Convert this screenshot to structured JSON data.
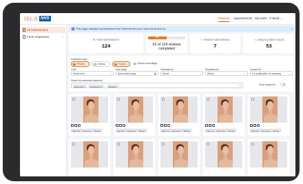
{
  "brand": {
    "logo_text": "ISLA",
    "nhs_badge": "NHS"
  },
  "nav": {
    "patients": "Patients",
    "appointments": "Appointments",
    "my_tasks": "My tasks",
    "user": "Bindi"
  },
  "sidebar": {
    "items": [
      {
        "label": "All submissions"
      },
      {
        "label": "Form responses"
      }
    ]
  },
  "banner": {
    "text": "This page displays submissions from Patients that you have full access to."
  },
  "stats": {
    "total_label": "Total submissions",
    "total_value": "124",
    "progress_badge": "50%",
    "progress_fraction": 0.5,
    "progress_text": "62 of 124 reviews completed",
    "patient_label": "Patient submissions",
    "patient_value": "7",
    "unique_label": "Unique patient count",
    "unique_value": "53"
  },
  "filters": {
    "submission_type_label": "Submission type",
    "chips": [
      {
        "label": "Photos",
        "on": true
      },
      {
        "label": "Videos",
        "on": false
      },
      {
        "label": "Forms",
        "on": true
      },
      {
        "label": "Sound recordings",
        "on": false
      }
    ],
    "form_label": "Form",
    "form_value": "Select form",
    "date_label": "Date range",
    "date_value": "Select date range",
    "submitted_label": "Submitted by",
    "submitted_value": "Select",
    "requested_label": "Requested by",
    "requested_value": "Select",
    "consent_label": "Consent for",
    "consent_value": "For publication, for teaching",
    "search_label": "Search by submission keywords",
    "tags": [
      "Align risk",
      "Cancerous",
      "Benign"
    ],
    "show_image_info": "Show image info"
  },
  "cards": {
    "tags": [
      "High risk",
      "Cancerous",
      "Benign"
    ]
  },
  "colors": {
    "accent": "#f97316",
    "nhs_blue": "#005eb8",
    "banner_bg": "#dbeafe"
  }
}
